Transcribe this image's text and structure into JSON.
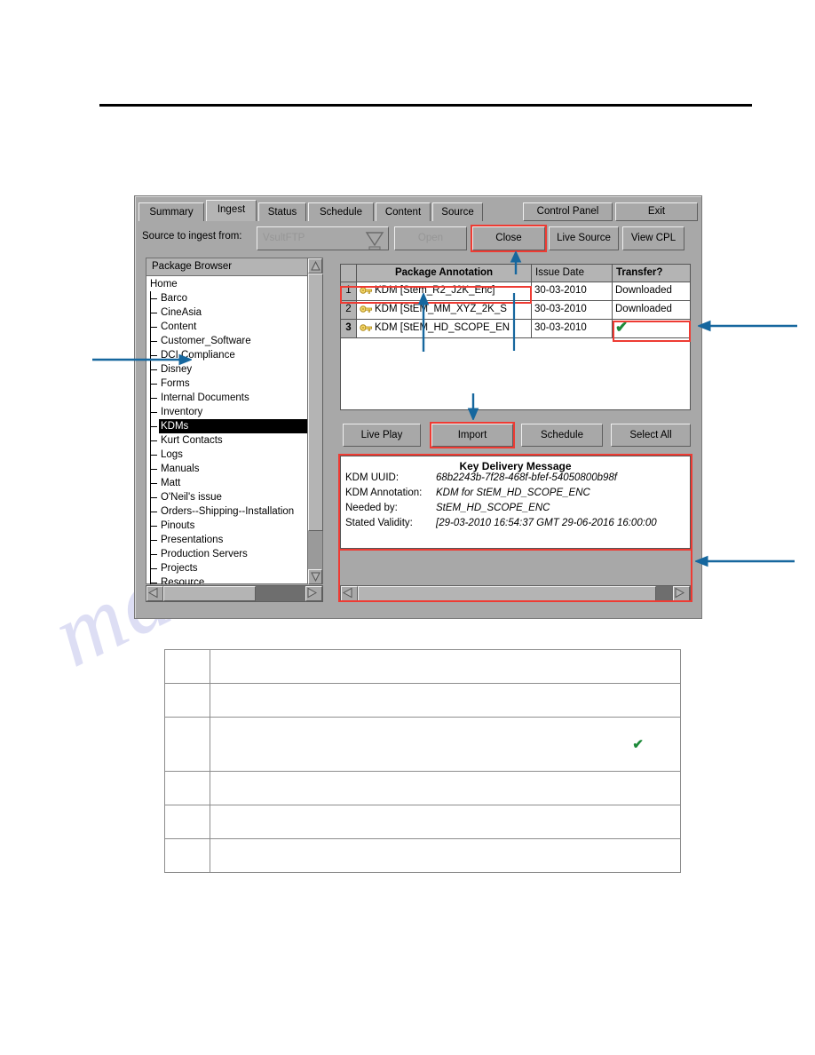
{
  "window": {
    "tabs": [
      {
        "label": "Summary",
        "active": false
      },
      {
        "label": "Ingest",
        "active": true
      },
      {
        "label": "Status",
        "active": false
      },
      {
        "label": "Schedule",
        "active": false
      },
      {
        "label": "Content",
        "active": false
      },
      {
        "label": "Source",
        "active": false
      }
    ],
    "top_buttons": [
      {
        "label": "Control Panel"
      },
      {
        "label": "Exit"
      }
    ]
  },
  "source_row": {
    "label": "Source to ingest from:",
    "combo_value": "VsultFTP",
    "buttons": [
      {
        "label": "Open",
        "disabled": true,
        "highlighted": false
      },
      {
        "label": "Close",
        "disabled": false,
        "highlighted": true
      },
      {
        "label": "Live Source",
        "disabled": false,
        "highlighted": false
      },
      {
        "label": "View CPL",
        "disabled": false,
        "highlighted": false
      }
    ]
  },
  "browser": {
    "title": "Package Browser",
    "root": "Home",
    "items": [
      {
        "label": "Barco",
        "selected": false
      },
      {
        "label": "CineAsia",
        "selected": false
      },
      {
        "label": "Content",
        "selected": false
      },
      {
        "label": "Customer_Software",
        "selected": false
      },
      {
        "label": "DCI Compliance",
        "selected": false
      },
      {
        "label": "Disney",
        "selected": false
      },
      {
        "label": "Forms",
        "selected": false
      },
      {
        "label": "Internal Documents",
        "selected": false
      },
      {
        "label": "Inventory",
        "selected": false
      },
      {
        "label": "KDMs",
        "selected": true
      },
      {
        "label": "Kurt Contacts",
        "selected": false
      },
      {
        "label": "Logs",
        "selected": false
      },
      {
        "label": "Manuals",
        "selected": false
      },
      {
        "label": "Matt",
        "selected": false
      },
      {
        "label": "O'Neil's issue",
        "selected": false
      },
      {
        "label": "Orders--Shipping--Installation",
        "selected": false
      },
      {
        "label": "Pinouts",
        "selected": false
      },
      {
        "label": "Presentations",
        "selected": false
      },
      {
        "label": "Production Servers",
        "selected": false
      },
      {
        "label": "Projects",
        "selected": false
      },
      {
        "label": "Resource",
        "selected": false
      }
    ]
  },
  "package_table": {
    "headers": {
      "index": "",
      "annotation": "Package Annotation",
      "issue_date": "Issue Date",
      "transfer": "Transfer?"
    },
    "rows": [
      {
        "index": "1",
        "icon": "key-icon",
        "annotation": "KDM [Stem_R2_J2K_Enc]",
        "issue_date": "30-03-2010",
        "transfer": "Downloaded",
        "checked": false
      },
      {
        "index": "2",
        "icon": "key-icon",
        "annotation": "KDM [StEM_MM_XYZ_2K_S",
        "issue_date": "30-03-2010",
        "transfer": "Downloaded",
        "checked": false
      },
      {
        "index": "3",
        "icon": "key-icon",
        "annotation": "KDM [StEM_HD_SCOPE_EN",
        "issue_date": "30-03-2010",
        "transfer": "",
        "checked": true
      }
    ]
  },
  "action_buttons": [
    {
      "label": "Live Play",
      "highlighted": false
    },
    {
      "label": "Import",
      "highlighted": true
    },
    {
      "label": "Schedule",
      "highlighted": false
    },
    {
      "label": "Select All",
      "highlighted": false
    }
  ],
  "kdm_panel": {
    "title": "Key Delivery Message",
    "fields": [
      {
        "key": "KDM UUID:",
        "value": "68b2243b-7f28-468f-bfef-54050800b98f"
      },
      {
        "key": "KDM Annotation:",
        "value": "KDM for StEM_HD_SCOPE_ENC"
      },
      {
        "key": "Needed by:",
        "value": "StEM_HD_SCOPE_ENC"
      },
      {
        "key": "Stated Validity:",
        "value": "[29-03-2010 16:54:37 GMT   29-06-2016 16:00:00"
      }
    ]
  },
  "lower_table": {
    "rows": [
      {
        "first": "",
        "second": "",
        "tall": false,
        "check": false
      },
      {
        "first": "",
        "second": "",
        "tall": false,
        "check": false
      },
      {
        "first": "",
        "second": "",
        "tall": true,
        "check": true
      },
      {
        "first": "",
        "second": "",
        "tall": false,
        "check": false
      },
      {
        "first": "",
        "second": "",
        "tall": false,
        "check": false
      },
      {
        "first": "",
        "second": "",
        "tall": false,
        "check": false
      }
    ]
  },
  "watermark": {
    "text": "manualsli.ke"
  },
  "colors": {
    "highlight": "#ee3b33",
    "annotation_arrow": "#16679e",
    "check": "#1d8a3a",
    "window_bg": "#a8a8a8"
  }
}
